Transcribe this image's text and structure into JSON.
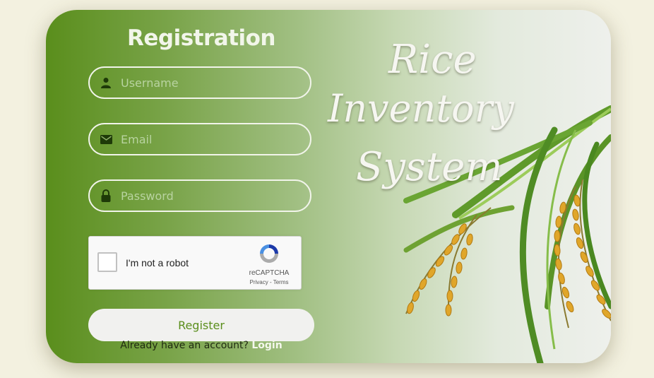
{
  "form": {
    "title": "Registration",
    "username_placeholder": "Username",
    "email_placeholder": "Email",
    "password_placeholder": "Password",
    "register_label": "Register",
    "login_prompt": "Already have an account?",
    "login_link": "Login"
  },
  "recaptcha": {
    "label": "I'm not a robot",
    "brand": "reCAPTCHA",
    "links": "Privacy - Terms"
  },
  "hero": {
    "line1": "Rice",
    "line2": "Inventory",
    "line3": "System"
  },
  "icons": {
    "username": "user-icon",
    "email": "envelope-icon",
    "password": "lock-icon",
    "recaptcha": "recaptcha-logo-icon"
  },
  "colors": {
    "accent": "#5a8e1c",
    "field_border": "#f1f4ea",
    "icon": "#1e3a08"
  }
}
